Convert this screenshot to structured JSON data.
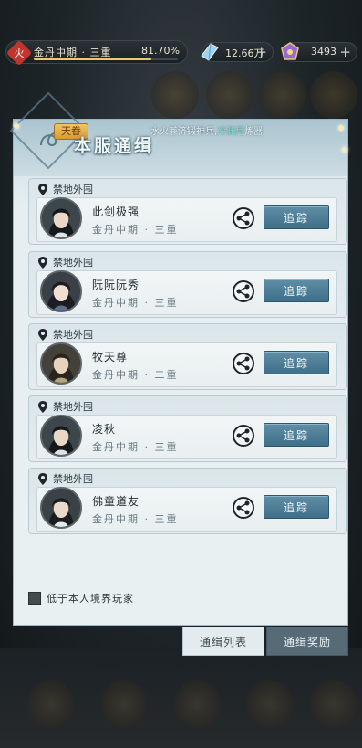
{
  "topbar": {
    "realm_badge": "火",
    "realm_name": "金丹中期 · 三重",
    "realm_progress": "81.70%",
    "realm_progress_value": 0.817,
    "spirit_stones": "12.66万",
    "jade": "3493",
    "plus": "+"
  },
  "panel": {
    "tag": "天眷",
    "title": "本服通缉",
    "ticker": {
      "prefix": "水火兼济锻神兵,",
      "highlight": "冷渊月",
      "suffix": "炼器"
    }
  },
  "entries": [
    {
      "location": "禁地外围",
      "name": "此剑极强",
      "realm": "金丹中期 · 三重",
      "track": "追踪"
    },
    {
      "location": "禁地外围",
      "name": "阮阮阮秀",
      "realm": "金丹中期 · 三重",
      "track": "追踪"
    },
    {
      "location": "禁地外围",
      "name": "牧天尊",
      "realm": "金丹中期 · 二重",
      "track": "追踪"
    },
    {
      "location": "禁地外围",
      "name": "凌秋",
      "realm": "金丹中期 · 三重",
      "track": "追踪"
    },
    {
      "location": "禁地外围",
      "name": "佛童道友",
      "realm": "金丹中期 · 三重",
      "track": "追踪"
    }
  ],
  "filter": {
    "label": "低于本人境界玩家",
    "checked": true
  },
  "tabs": {
    "list": "通缉列表",
    "reward": "通缉奖励",
    "active": "list"
  },
  "colors": {
    "track_button": "#4f7f98",
    "accent_gold": "#e9c976",
    "ticker_highlight": "#7fe3d2"
  }
}
